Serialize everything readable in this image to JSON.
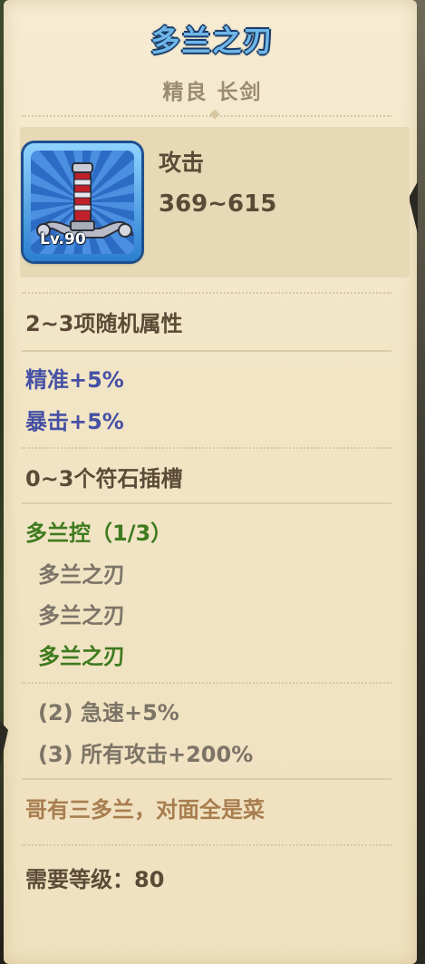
{
  "item": {
    "name": "多兰之刃",
    "quality_type": "精良 长剑",
    "level_badge": "Lv.90",
    "icon": "sword-icon"
  },
  "stats": {
    "label": "攻击",
    "value": "369~615"
  },
  "random_attrs": {
    "header": "2~3项随机属性",
    "items": [
      "精准+5%",
      "暴击+5%"
    ]
  },
  "rune_slots": "0~3个符石插槽",
  "set": {
    "title": "多兰控（1/3）",
    "pieces": [
      {
        "name": "多兰之刃",
        "owned": false
      },
      {
        "name": "多兰之刃",
        "owned": false
      },
      {
        "name": "多兰之刃",
        "owned": true
      }
    ],
    "bonuses": [
      "(2) 急速+5%",
      "(3) 所有攻击+200%"
    ]
  },
  "flavor": "哥有三多兰，对面全是菜",
  "requirement": "需要等级：80",
  "colors": {
    "title": "#6fb6e8",
    "random_attr": "#4650a4",
    "set_active": "#3e7a1e",
    "set_inactive": "#7c7466",
    "flavor": "#a87d4f"
  }
}
